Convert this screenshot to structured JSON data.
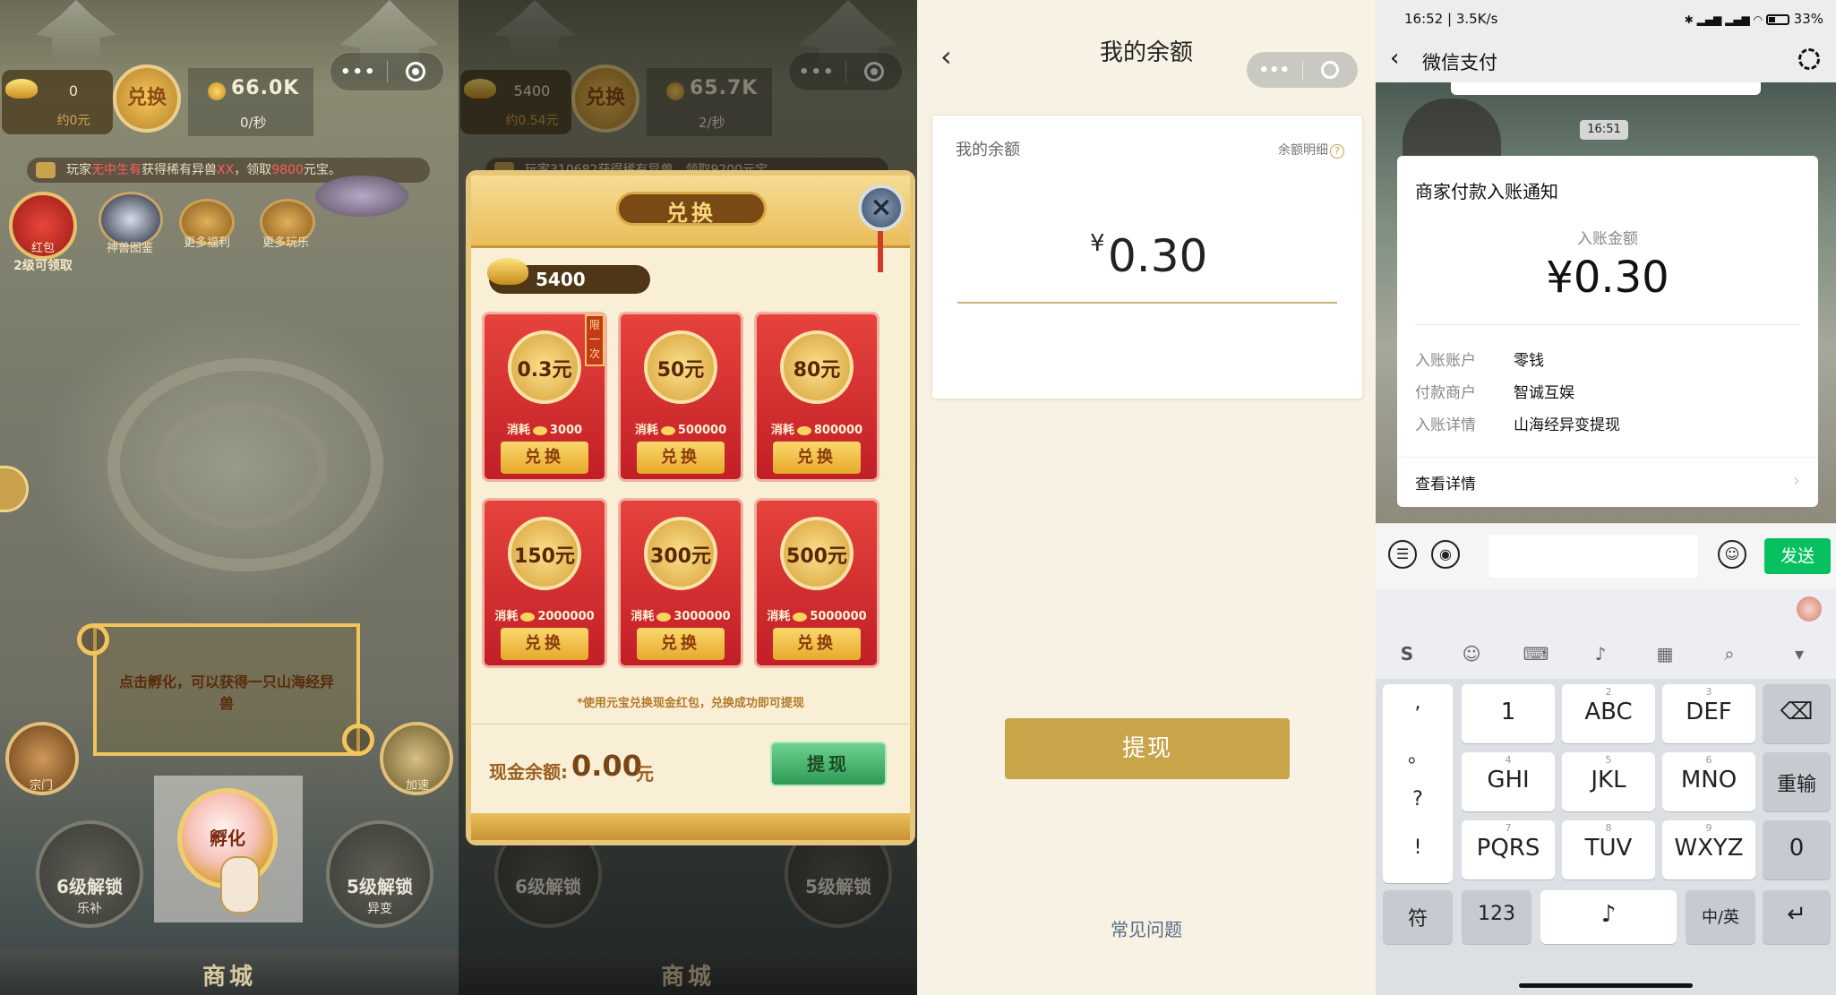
{
  "panel1": {
    "capsule_dots": "•••",
    "gold_amount": "0",
    "gold_sub": "约0元",
    "exchange_label": "兑换",
    "coin_value": "66.0K",
    "coin_rate": "0/秒",
    "marquee_prefix": "玩家",
    "marquee_player": "无中生有",
    "marquee_mid": "获得稀有异兽",
    "marquee_red": "XX",
    "marquee_mid2": "，领取",
    "marquee_amount": "9800",
    "marquee_suffix": "元宝。",
    "icons": [
      {
        "label": "红包",
        "sub": "2级可领取"
      },
      {
        "label": "神兽图鉴"
      },
      {
        "label": "更多福利"
      },
      {
        "label": "更多玩乐"
      }
    ],
    "hint_text": "点击孵化，可以获得一只山海经异兽",
    "hatch_label": "孵化",
    "left_side_label": "宗门",
    "right_side_label": "加速",
    "lock_left": {
      "label": "6级解锁",
      "sub": "乐补"
    },
    "lock_right": {
      "label": "5级解锁",
      "sub": "异变"
    },
    "shop_label": "商城"
  },
  "panel2": {
    "gold_amount": "5400",
    "gold_sub": "约0.54元",
    "exchange_label": "兑换",
    "coin_value": "65.7K",
    "coin_rate": "2/秒",
    "marquee": "玩家310682获得稀有异兽，领取9200元宝",
    "modal_title": "兑换",
    "close_icon": "×",
    "balance": "5400",
    "limit_tag": "限一次",
    "cards": [
      {
        "amount": "0.3元",
        "cost_label": "消耗",
        "cost": "3000",
        "btn": "兑换"
      },
      {
        "amount": "50元",
        "cost_label": "消耗",
        "cost": "500000",
        "btn": "兑换"
      },
      {
        "amount": "80元",
        "cost_label": "消耗",
        "cost": "800000",
        "btn": "兑换"
      },
      {
        "amount": "150元",
        "cost_label": "消耗",
        "cost": "2000000",
        "btn": "兑换"
      },
      {
        "amount": "300元",
        "cost_label": "消耗",
        "cost": "3000000",
        "btn": "兑换"
      },
      {
        "amount": "500元",
        "cost_label": "消耗",
        "cost": "5000000",
        "btn": "兑换"
      }
    ],
    "note": "*使用元宝兑换现金红包，兑换成功即可提现",
    "cash_label": "现金余额:",
    "cash_value": "0.00",
    "cash_unit": "元",
    "withdraw_label": "提现",
    "lock_left": "6级解锁",
    "lock_right": "5级解锁",
    "shop_label": "商城"
  },
  "panel3": {
    "title": "我的余额",
    "back_icon": "‹",
    "card_label": "我的余额",
    "detail_link": "余额明细",
    "detail_q": "?",
    "currency": "¥",
    "amount": "0.30",
    "withdraw_label": "提现",
    "faq_label": "常见问题"
  },
  "panel4": {
    "status_left": "16:52 | 3.5K/s",
    "status_right": "33%",
    "title": "微信支付",
    "timestamp": "16:51",
    "card_title": "商家付款入账通知",
    "amount_label": "入账金额",
    "amount": "¥0.30",
    "rows": [
      {
        "key": "入账账户",
        "value": "零钱"
      },
      {
        "key": "付款商户",
        "value": "智诚互娱"
      },
      {
        "key": "入账详情",
        "value": "山海经异变提现"
      }
    ],
    "more_label": "查看详情",
    "send_label": "发送",
    "keys": {
      "punct": [
        ",",
        "。",
        "?",
        "!"
      ],
      "row1": [
        {
          "num": "",
          "main": "1"
        },
        {
          "num": "2",
          "main": "ABC"
        },
        {
          "num": "3",
          "main": "DEF"
        }
      ],
      "row2": [
        {
          "num": "4",
          "main": "GHI"
        },
        {
          "num": "5",
          "main": "JKL"
        },
        {
          "num": "6",
          "main": "MNO"
        }
      ],
      "row3": [
        {
          "num": "7",
          "main": "PQRS"
        },
        {
          "num": "8",
          "main": "TUV"
        },
        {
          "num": "9",
          "main": "WXYZ"
        }
      ],
      "backspace": "⌫",
      "reinput": "重输",
      "zero": "0",
      "symbol": "符",
      "num123": "123",
      "lang": "中/英",
      "enter": "↵"
    }
  }
}
